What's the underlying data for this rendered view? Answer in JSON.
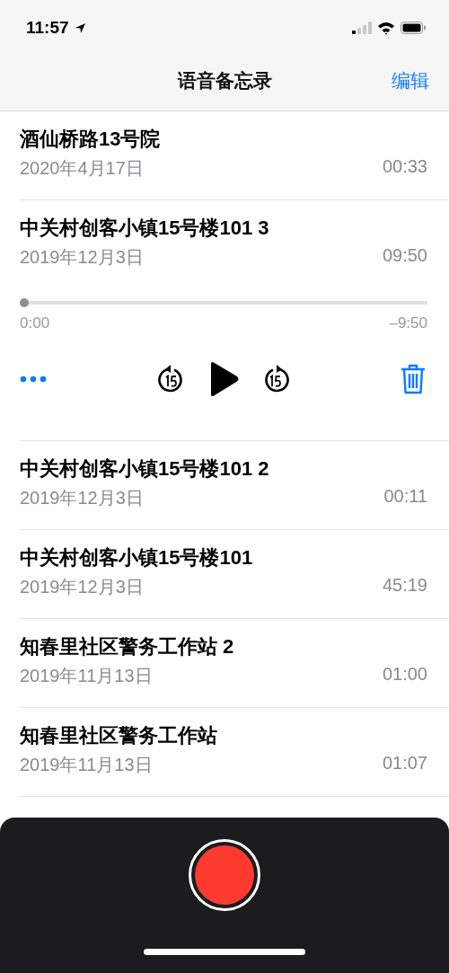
{
  "status_bar": {
    "time": "11:57"
  },
  "nav": {
    "title": "语音备忘录",
    "edit": "编辑"
  },
  "recordings": [
    {
      "title": "酒仙桥路13号院",
      "date": "2020年4月17日",
      "duration": "00:33",
      "selected": false
    },
    {
      "title": "中关村创客小镇15号楼101 3",
      "date": "2019年12月3日",
      "duration": "09:50",
      "selected": true,
      "player": {
        "level": 0,
        "elapsed": "0:00",
        "remaining": "–9:50"
      }
    },
    {
      "title": "中关村创客小镇15号楼101 2",
      "date": "2019年12月3日",
      "duration": "00:11",
      "selected": false
    },
    {
      "title": "中关村创客小镇15号楼101",
      "date": "2019年12月3日",
      "duration": "45:19",
      "selected": false
    },
    {
      "title": "知春里社区警务工作站 2",
      "date": "2019年11月13日",
      "duration": "01:00",
      "selected": false
    },
    {
      "title": "知春里社区警务工作站",
      "date": "2019年11月13日",
      "duration": "01:07",
      "selected": false
    }
  ]
}
